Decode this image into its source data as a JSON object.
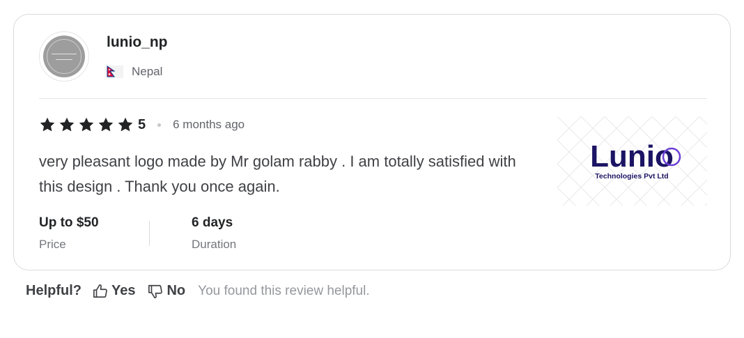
{
  "reviewer": {
    "username": "lunio_np",
    "country": "Nepal",
    "avatar_icon": "company-logo-avatar"
  },
  "review": {
    "rating_value": "5",
    "stars": 5,
    "time_ago": "6 months ago",
    "text": "very pleasant logo made by Mr golam rabby . I am totally satisfied with this design . Thank you once again.",
    "thumbnail": {
      "brand_text": "Lunio",
      "tagline": "Technologies Pvt Ltd"
    }
  },
  "meta": [
    {
      "value": "Up to $50",
      "label": "Price"
    },
    {
      "value": "6 days",
      "label": "Duration"
    }
  ],
  "helpful": {
    "label": "Helpful?",
    "yes_label": "Yes",
    "no_label": "No",
    "message": "You found this review helpful."
  },
  "colors": {
    "star": "#222325",
    "brand_navy": "#1b1464",
    "brand_purple": "#6c3fd6"
  }
}
